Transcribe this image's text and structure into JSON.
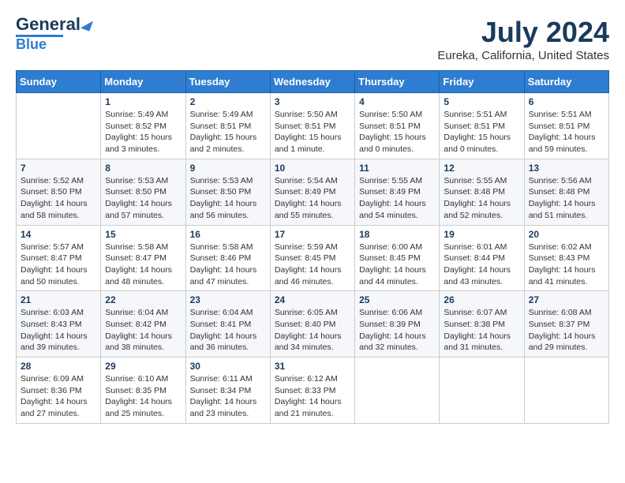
{
  "header": {
    "logo_general": "General",
    "logo_blue": "Blue",
    "title": "July 2024",
    "subtitle": "Eureka, California, United States"
  },
  "weekdays": [
    "Sunday",
    "Monday",
    "Tuesday",
    "Wednesday",
    "Thursday",
    "Friday",
    "Saturday"
  ],
  "weeks": [
    {
      "alt": false,
      "days": [
        {
          "num": "",
          "info": ""
        },
        {
          "num": "1",
          "info": "Sunrise: 5:49 AM\nSunset: 8:52 PM\nDaylight: 15 hours\nand 3 minutes."
        },
        {
          "num": "2",
          "info": "Sunrise: 5:49 AM\nSunset: 8:51 PM\nDaylight: 15 hours\nand 2 minutes."
        },
        {
          "num": "3",
          "info": "Sunrise: 5:50 AM\nSunset: 8:51 PM\nDaylight: 15 hours\nand 1 minute."
        },
        {
          "num": "4",
          "info": "Sunrise: 5:50 AM\nSunset: 8:51 PM\nDaylight: 15 hours\nand 0 minutes."
        },
        {
          "num": "5",
          "info": "Sunrise: 5:51 AM\nSunset: 8:51 PM\nDaylight: 15 hours\nand 0 minutes."
        },
        {
          "num": "6",
          "info": "Sunrise: 5:51 AM\nSunset: 8:51 PM\nDaylight: 14 hours\nand 59 minutes."
        }
      ]
    },
    {
      "alt": true,
      "days": [
        {
          "num": "7",
          "info": "Sunrise: 5:52 AM\nSunset: 8:50 PM\nDaylight: 14 hours\nand 58 minutes."
        },
        {
          "num": "8",
          "info": "Sunrise: 5:53 AM\nSunset: 8:50 PM\nDaylight: 14 hours\nand 57 minutes."
        },
        {
          "num": "9",
          "info": "Sunrise: 5:53 AM\nSunset: 8:50 PM\nDaylight: 14 hours\nand 56 minutes."
        },
        {
          "num": "10",
          "info": "Sunrise: 5:54 AM\nSunset: 8:49 PM\nDaylight: 14 hours\nand 55 minutes."
        },
        {
          "num": "11",
          "info": "Sunrise: 5:55 AM\nSunset: 8:49 PM\nDaylight: 14 hours\nand 54 minutes."
        },
        {
          "num": "12",
          "info": "Sunrise: 5:55 AM\nSunset: 8:48 PM\nDaylight: 14 hours\nand 52 minutes."
        },
        {
          "num": "13",
          "info": "Sunrise: 5:56 AM\nSunset: 8:48 PM\nDaylight: 14 hours\nand 51 minutes."
        }
      ]
    },
    {
      "alt": false,
      "days": [
        {
          "num": "14",
          "info": "Sunrise: 5:57 AM\nSunset: 8:47 PM\nDaylight: 14 hours\nand 50 minutes."
        },
        {
          "num": "15",
          "info": "Sunrise: 5:58 AM\nSunset: 8:47 PM\nDaylight: 14 hours\nand 48 minutes."
        },
        {
          "num": "16",
          "info": "Sunrise: 5:58 AM\nSunset: 8:46 PM\nDaylight: 14 hours\nand 47 minutes."
        },
        {
          "num": "17",
          "info": "Sunrise: 5:59 AM\nSunset: 8:45 PM\nDaylight: 14 hours\nand 46 minutes."
        },
        {
          "num": "18",
          "info": "Sunrise: 6:00 AM\nSunset: 8:45 PM\nDaylight: 14 hours\nand 44 minutes."
        },
        {
          "num": "19",
          "info": "Sunrise: 6:01 AM\nSunset: 8:44 PM\nDaylight: 14 hours\nand 43 minutes."
        },
        {
          "num": "20",
          "info": "Sunrise: 6:02 AM\nSunset: 8:43 PM\nDaylight: 14 hours\nand 41 minutes."
        }
      ]
    },
    {
      "alt": true,
      "days": [
        {
          "num": "21",
          "info": "Sunrise: 6:03 AM\nSunset: 8:43 PM\nDaylight: 14 hours\nand 39 minutes."
        },
        {
          "num": "22",
          "info": "Sunrise: 6:04 AM\nSunset: 8:42 PM\nDaylight: 14 hours\nand 38 minutes."
        },
        {
          "num": "23",
          "info": "Sunrise: 6:04 AM\nSunset: 8:41 PM\nDaylight: 14 hours\nand 36 minutes."
        },
        {
          "num": "24",
          "info": "Sunrise: 6:05 AM\nSunset: 8:40 PM\nDaylight: 14 hours\nand 34 minutes."
        },
        {
          "num": "25",
          "info": "Sunrise: 6:06 AM\nSunset: 8:39 PM\nDaylight: 14 hours\nand 32 minutes."
        },
        {
          "num": "26",
          "info": "Sunrise: 6:07 AM\nSunset: 8:38 PM\nDaylight: 14 hours\nand 31 minutes."
        },
        {
          "num": "27",
          "info": "Sunrise: 6:08 AM\nSunset: 8:37 PM\nDaylight: 14 hours\nand 29 minutes."
        }
      ]
    },
    {
      "alt": false,
      "days": [
        {
          "num": "28",
          "info": "Sunrise: 6:09 AM\nSunset: 8:36 PM\nDaylight: 14 hours\nand 27 minutes."
        },
        {
          "num": "29",
          "info": "Sunrise: 6:10 AM\nSunset: 8:35 PM\nDaylight: 14 hours\nand 25 minutes."
        },
        {
          "num": "30",
          "info": "Sunrise: 6:11 AM\nSunset: 8:34 PM\nDaylight: 14 hours\nand 23 minutes."
        },
        {
          "num": "31",
          "info": "Sunrise: 6:12 AM\nSunset: 8:33 PM\nDaylight: 14 hours\nand 21 minutes."
        },
        {
          "num": "",
          "info": ""
        },
        {
          "num": "",
          "info": ""
        },
        {
          "num": "",
          "info": ""
        }
      ]
    }
  ]
}
